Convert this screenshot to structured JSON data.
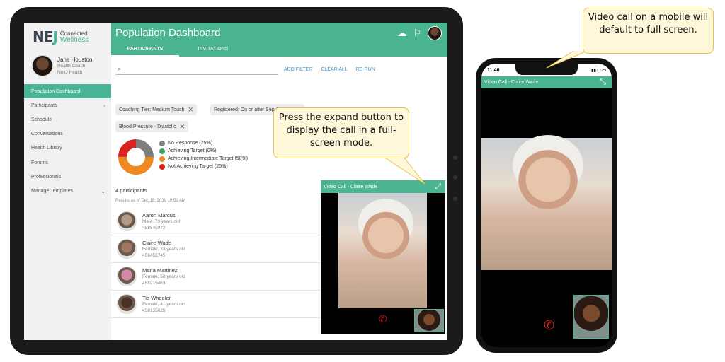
{
  "logo": {
    "mark_left": "NE",
    "mark_j": "J",
    "text_top": "Connected",
    "text_bottom": "Wellness"
  },
  "profile": {
    "name": "Jane Houston",
    "role": "Health Coach",
    "org": "NexJ Health"
  },
  "nav": [
    {
      "label": "Population Dashboard",
      "active": true,
      "chevron": ""
    },
    {
      "label": "Participants",
      "chevron": "›"
    },
    {
      "label": "Schedule",
      "chevron": ""
    },
    {
      "label": "Conversations",
      "chevron": ""
    },
    {
      "label": "Health Library",
      "chevron": ""
    },
    {
      "label": "Forums",
      "chevron": ""
    },
    {
      "label": "Professionals",
      "chevron": ""
    },
    {
      "label": "Manage Templates",
      "chevron": "⌄"
    }
  ],
  "header": {
    "title": "Population Dashboard",
    "tabs": [
      "PARTICIPANTS",
      "INVITATIONS"
    ],
    "icons": [
      "chat-icon",
      "flag-icon"
    ]
  },
  "search": {
    "value": "",
    "actions": [
      "ADD FILTER",
      "CLEAR ALL",
      "RE-RUN"
    ]
  },
  "filters": [
    "Coaching Tier: Medium Touch",
    "Registered: On or after Sep 1, 2019",
    "Blood Pressure - Diastolic"
  ],
  "chart_data": {
    "type": "pie",
    "categories": [
      "No Response (25%)",
      "Achieving Target (0%)",
      "Achieving Intermediate Target (50%)",
      "Not Achieving Target (25%)"
    ],
    "values": [
      25,
      0,
      50,
      25
    ],
    "colors": [
      "#7d7d7d",
      "#3aa46b",
      "#ef8a22",
      "#d8231f"
    ]
  },
  "participants_count": "4 participants",
  "results_time": "Results as of Dec 18, 2019 10:51 AM",
  "participants": [
    {
      "name": "Aaron Marcus",
      "meta": "Male, 73 years old",
      "id": "458645872",
      "avatar_color": "#b49a86"
    },
    {
      "name": "Claire Wade",
      "meta": "Female, 33 years old",
      "id": "458458745",
      "avatar_color": "#a0785d"
    },
    {
      "name": "Maria Martinez",
      "meta": "Female, 58 years old",
      "id": "458215463",
      "avatar_color": "#d48aa6"
    },
    {
      "name": "Tia Wheeler",
      "meta": "Female, 41 years old",
      "id": "458135625",
      "avatar_color": "#4a3326"
    }
  ],
  "video_call": {
    "title": "Video Call - Claire Wade",
    "expand_icon": "⤢",
    "hangup_icon": "✆"
  },
  "phone": {
    "time": "11:40",
    "status_icons": "▮▮ ◠ ▭",
    "call_title": "Video Call - Claire Wade",
    "collapse_icon": "⤡",
    "hangup_icon": "✆"
  },
  "callouts": {
    "tablet": "Press the expand button to display the call in a full-screen mode.",
    "phone": "Video call on a mobile will default to full screen."
  }
}
